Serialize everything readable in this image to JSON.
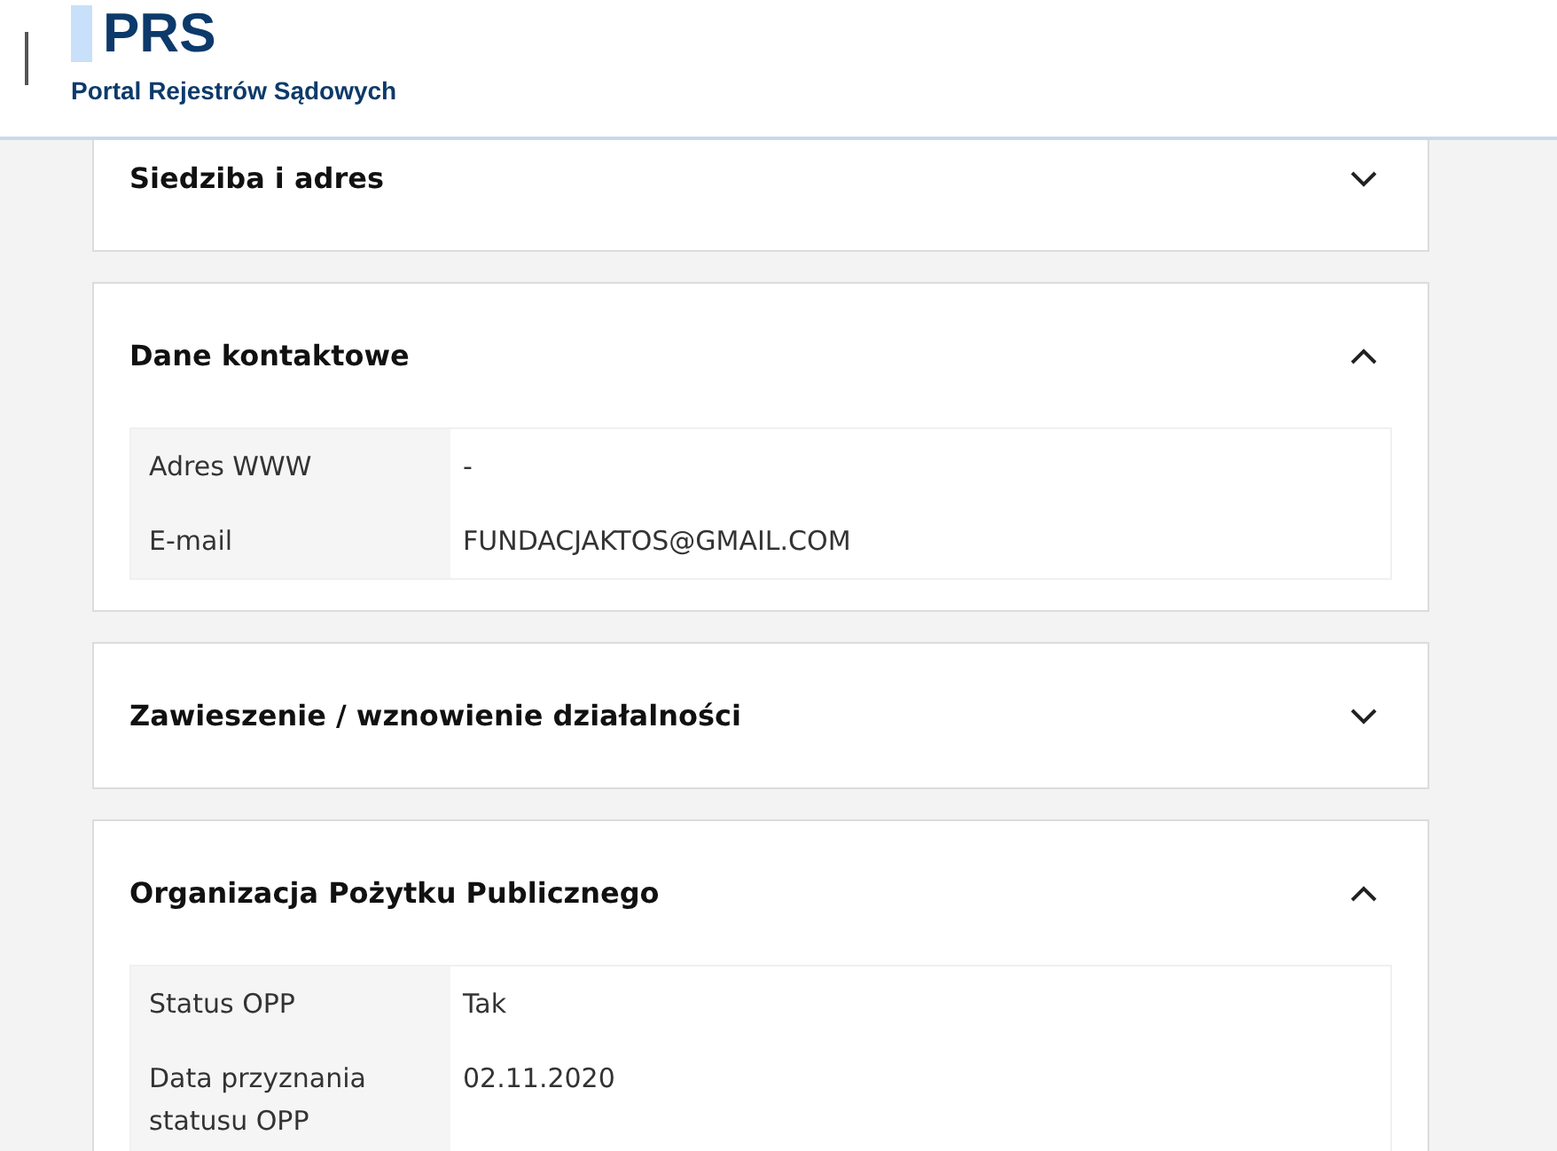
{
  "header": {
    "logo": "PRS",
    "subtitle": "Portal Rejestrów Sądowych"
  },
  "sections": [
    {
      "title": "Siedziba i adres",
      "expanded": false
    },
    {
      "title": "Dane kontaktowe",
      "expanded": true,
      "rows": [
        {
          "label": "Adres WWW",
          "value": "-"
        },
        {
          "label": "E-mail",
          "value": "FUNDACJAKTOS@GMAIL.COM"
        }
      ]
    },
    {
      "title": "Zawieszenie / wznowienie działalności",
      "expanded": false
    },
    {
      "title": "Organizacja Pożytku Publicznego",
      "expanded": true,
      "rows": [
        {
          "label": "Status OPP",
          "value": "Tak"
        },
        {
          "label": "Data przyznania statusu OPP",
          "value": "02.11.2020"
        }
      ]
    }
  ]
}
